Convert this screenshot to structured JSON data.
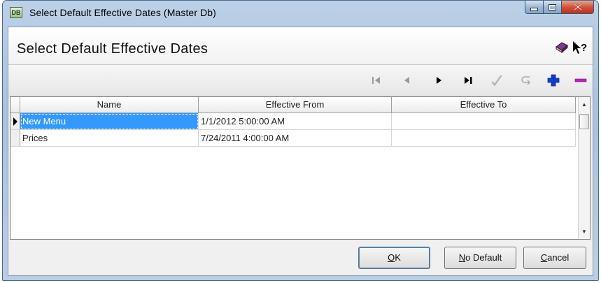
{
  "window": {
    "title": "Select Default Effective Dates (Master Db)",
    "icon": "database-icon"
  },
  "header": {
    "title": "Select Default Effective Dates"
  },
  "toolbar": {
    "items": [
      "first-record-icon",
      "previous-record-icon",
      "next-record-icon",
      "last-record-icon",
      "post-edit-icon",
      "cancel-edit-icon",
      "insert-record-icon",
      "delete-record-icon"
    ],
    "accent_add": "#1040d0",
    "accent_delete": "#c020c0"
  },
  "grid": {
    "columns": [
      "Name",
      "Effective From",
      "Effective To"
    ],
    "rows": [
      {
        "name": "New Menu",
        "from": "1/1/2012 5:00:00 AM",
        "to": ""
      },
      {
        "name": "Prices",
        "from": "7/24/2011 4:00:00 AM",
        "to": ""
      }
    ],
    "selection_color": "#3399ff"
  },
  "buttons": {
    "ok": {
      "mnemonic": "O",
      "rest": "K"
    },
    "no_default": {
      "mnemonic": "N",
      "rest": "o Default"
    },
    "cancel": {
      "mnemonic": "C",
      "rest": "ancel"
    }
  }
}
